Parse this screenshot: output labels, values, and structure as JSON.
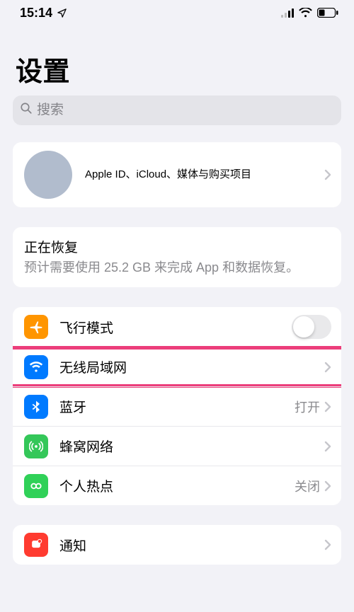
{
  "status": {
    "time": "15:14"
  },
  "title": "设置",
  "search": {
    "placeholder": "搜索"
  },
  "appleId": {
    "subtitle": "Apple ID、iCloud、媒体与购买项目"
  },
  "restore": {
    "title": "正在恢复",
    "subtitle": "预计需要使用 25.2 GB 来完成 App 和数据恢复。"
  },
  "rows": {
    "airplane": {
      "label": "飞行模式"
    },
    "wifi": {
      "label": "无线局域网"
    },
    "bluetooth": {
      "label": "蓝牙",
      "detail": "打开"
    },
    "cellular": {
      "label": "蜂窝网络"
    },
    "hotspot": {
      "label": "个人热点",
      "detail": "关闭"
    },
    "notifications": {
      "label": "通知"
    }
  }
}
